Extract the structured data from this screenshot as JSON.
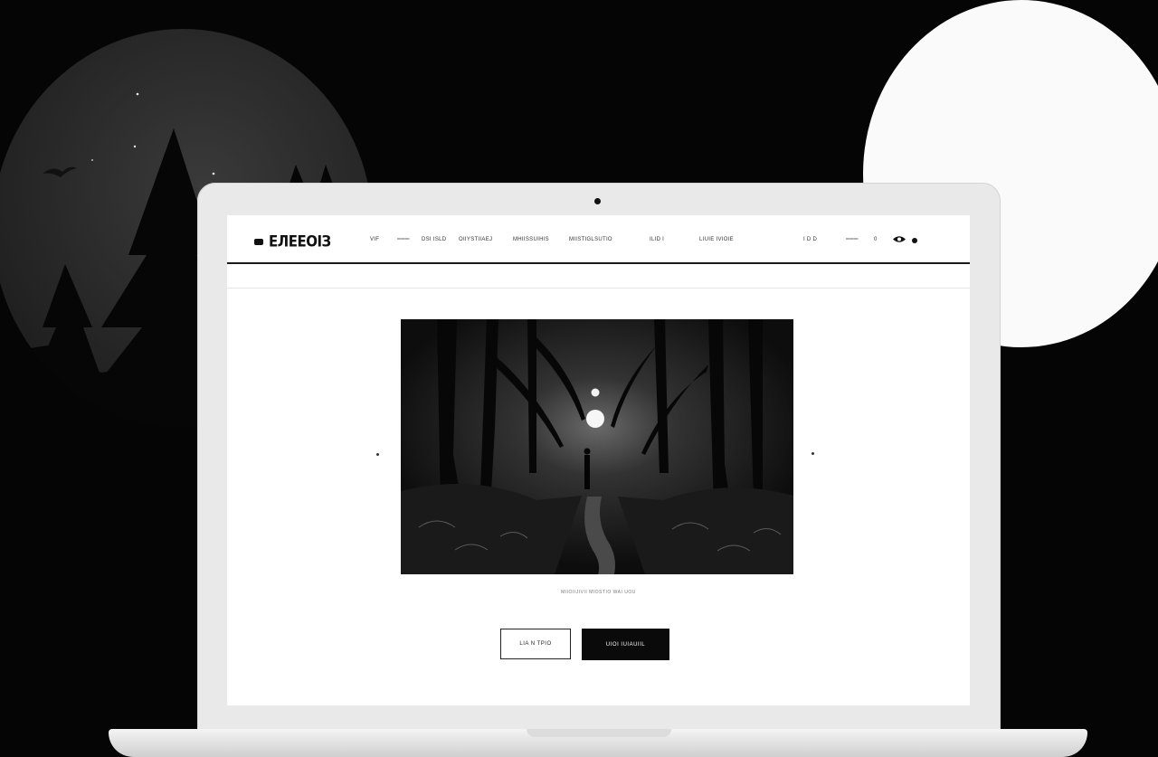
{
  "site": {
    "logo_text": "ЕЛЕЕОІЗ"
  },
  "nav": {
    "items": [
      "VIF",
      "═══",
      "DSI ISLD",
      "OIIYSTIIAEJ",
      "MHIISSUIHIS",
      "MIISTIGLSUTIO",
      "ILID  I",
      "LIUIE IVIOIE"
    ],
    "right_items": [
      "I D D",
      "═══",
      "0"
    ]
  },
  "hero": {
    "caption": "MIIOIIJIVII MIOSTIO WAI UOU"
  },
  "buttons": {
    "secondary_label": "LIA N TPIO",
    "primary_label": "UIOI IUIAUIIL"
  },
  "colors": {
    "background": "#050505",
    "screen": "#ffffff",
    "accent": "#0a0a0a"
  },
  "icons": {
    "logo": "logo-mark-icon",
    "view": "eye-icon",
    "account": "user-dot-icon",
    "prev": "prev-arrow-icon",
    "next": "next-arrow-icon"
  }
}
